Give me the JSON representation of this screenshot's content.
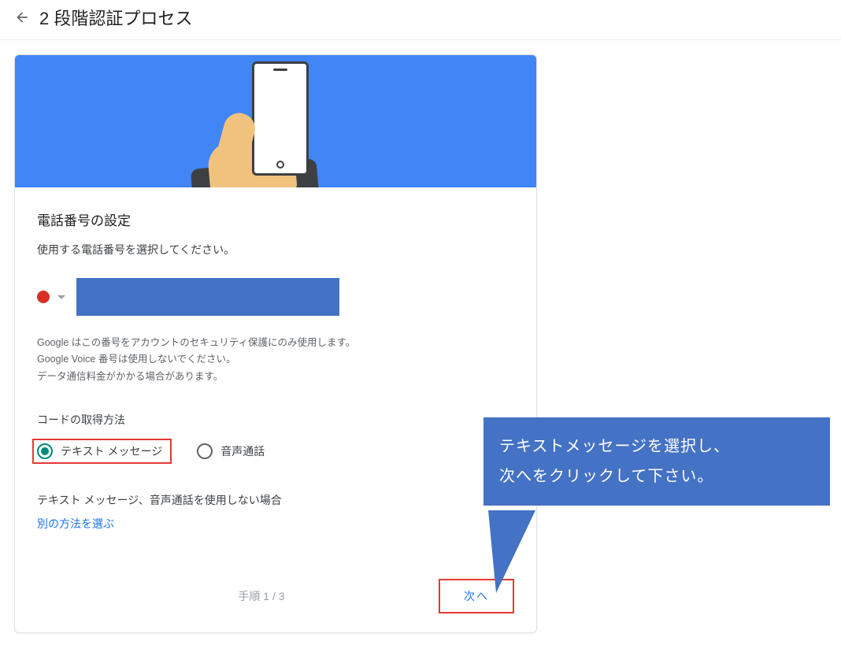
{
  "header": {
    "title": "2 段階認証プロセス"
  },
  "main": {
    "section_title": "電話番号の設定",
    "section_sub": "使用する電話番号を選択してください。",
    "disclaimer_line1": "Google はこの番号をアカウントのセキュリティ保護にのみ使用します。",
    "disclaimer_line2": "Google Voice 番号は使用しないでください。",
    "disclaimer_line3": "データ通信料金がかかる場合があります。",
    "code_label": "コードの取得方法",
    "radio_text": "テキスト メッセージ",
    "radio_voice": "音声通話",
    "no_sms_label": "テキスト メッセージ、音声通話を使用しない場合",
    "alt_link": "別の方法を選ぶ",
    "step": "手順 1 / 3",
    "next": "次へ"
  },
  "callout": {
    "line1": "テキストメッセージを選択し、",
    "line2": "次へをクリックして下さい。"
  }
}
